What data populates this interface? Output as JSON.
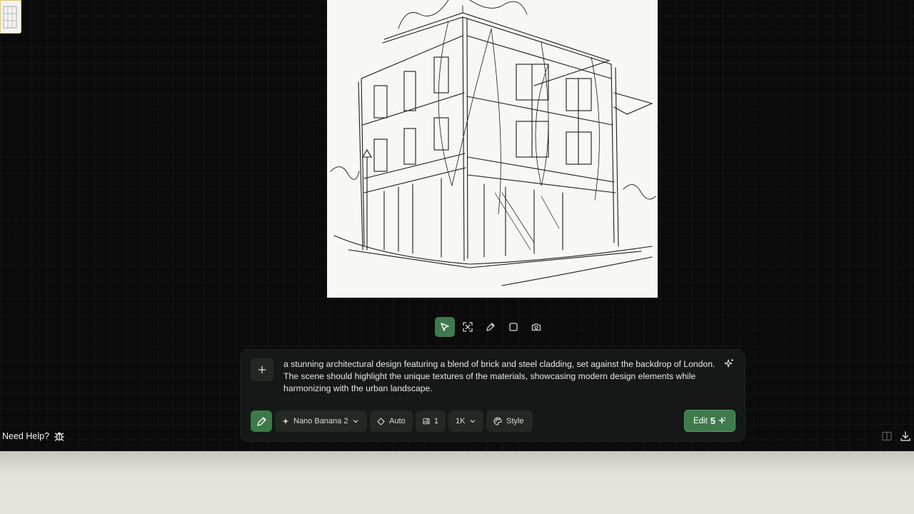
{
  "prompt": {
    "text": "a stunning architectural design featuring a blend of brick and steel cladding, set against the backdrop of London. The scene should highlight the unique textures of the materials, showcasing modern design elements while harmonizing with the urban landscape."
  },
  "controls": {
    "model_label": "Nano Banana 2",
    "aspect_label": "Auto",
    "image_count": "1",
    "resolution_label": "1K",
    "style_label": "Style"
  },
  "edit_button": {
    "label": "Edit",
    "count": "5"
  },
  "help": {
    "label": "Need Help?"
  },
  "colors": {
    "accent": "#3f7a4c",
    "canvas_bg": "#0b0b0b",
    "panel_bg": "#151816"
  },
  "icons": {
    "toolbar": [
      "select-cursor-icon",
      "fit-screen-icon",
      "pen-icon",
      "rectangle-icon",
      "camera-icon"
    ],
    "prompt": [
      "plus-icon",
      "sparkle-icon"
    ],
    "footer": [
      "bug-icon",
      "split-view-icon",
      "download-icon"
    ]
  }
}
